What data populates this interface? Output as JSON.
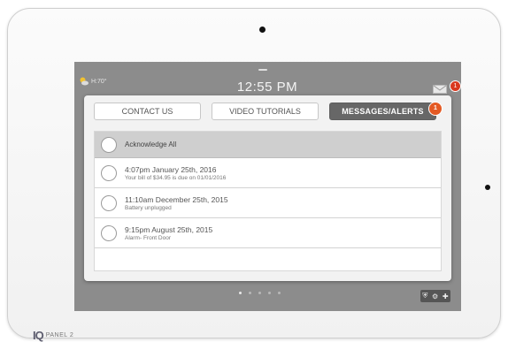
{
  "status_bar": {
    "weather_temp": "H:70°",
    "time": "12:55 PM",
    "notification_count": "1"
  },
  "tabs": [
    {
      "label": "CONTACT US",
      "active": false
    },
    {
      "label": "VIDEO TUTORIALS",
      "active": false
    },
    {
      "label": "MESSAGES/ALERTS",
      "active": true,
      "badge": "1"
    }
  ],
  "messages": {
    "acknowledge_all_label": "Acknowledge All",
    "items": [
      {
        "title": "4:07pm January 25th, 2016",
        "body": "Your bill of $34.95 is due on 01/01/2016"
      },
      {
        "title": "11:10am December 25th, 2015",
        "body": "Battery unplugged"
      },
      {
        "title": "9:15pm August 25th, 2015",
        "body": "Alarm- Front Door"
      }
    ]
  },
  "pager": {
    "pages": 5,
    "current": 1
  },
  "quick_icons": [
    "shield-icon",
    "gear-icon",
    "plus-icon"
  ],
  "brand": {
    "logo": "IQ",
    "name": "PANEL 2"
  },
  "colors": {
    "screen_bg": "#8c8c8c",
    "active_tab": "#676767",
    "badge": "#e45a24"
  }
}
